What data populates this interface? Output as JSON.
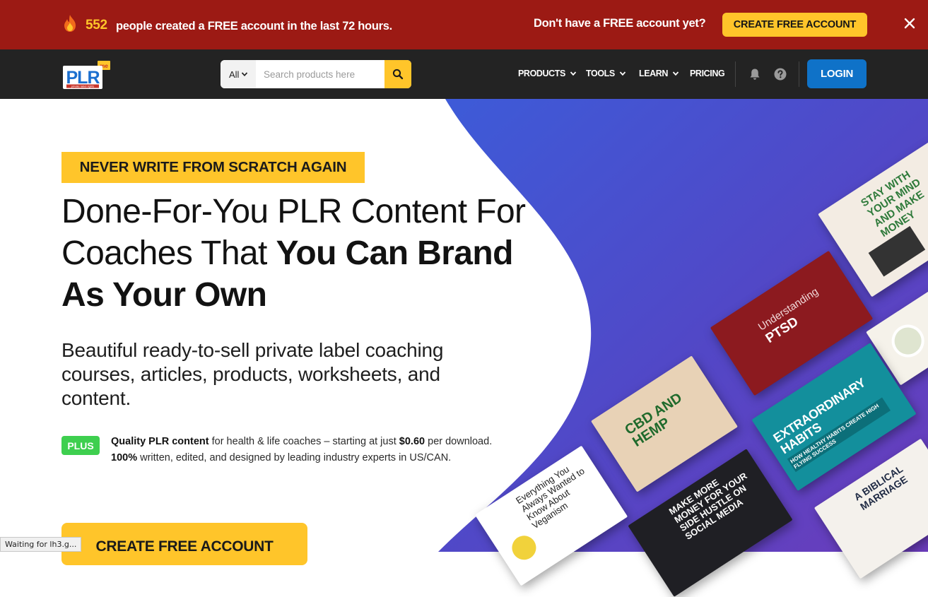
{
  "announcement": {
    "count": "552",
    "message": "people created a FREE account in the last 72 hours.",
    "question": "Don't have a FREE account yet?",
    "cta_label": "CREATE FREE ACCOUNT"
  },
  "nav": {
    "logo_text": "PLR",
    "logo_badge": "me",
    "logo_tagline": "private label rights",
    "search": {
      "category": "All",
      "placeholder": "Search products here"
    },
    "menu": [
      {
        "label": "PRODUCTS"
      },
      {
        "label": "TOOLS"
      },
      {
        "label": "LEARN"
      },
      {
        "label": "PRICING"
      }
    ],
    "login_label": "LOGIN"
  },
  "hero": {
    "tagline": "NEVER WRITE FROM SCRATCH AGAIN",
    "headline_regular": "Done-For-You PLR Content For Coaches That",
    "headline_bold": "You Can Brand As Your Own",
    "subheadline": "Beautiful ready-to-sell private label coaching courses, articles, products, worksheets, and content.",
    "plus_badge": "PLUS",
    "feature_bold_1": "Quality PLR content",
    "feature_text_1": "for health & life coaches – starting at just",
    "feature_price": "$0.60",
    "feature_text_2": "per download.",
    "feature_bold_2": "100%",
    "feature_text_3": "written, edited, and designed by leading industry experts in US/CAN.",
    "cta_label": "CREATE FREE ACCOUNT"
  },
  "covers": {
    "ptsd_title": "PTSD",
    "ptsd_pre": "Understanding",
    "cbd_title": "CBD AND HEMP",
    "habits_title": "EXTRAORDINARY HABITS",
    "habits_sub": "HOW HEALTHY HABITS CREATE HIGH FLYING SUCCESS",
    "vegan_title": "Everything You Always Wanted to Know About Veganism",
    "money_title": "MAKE MORE MONEY FOR YOUR SIDE HUSTLE ON SOCIAL MEDIA",
    "marriage_title": "A BIBLICAL MARRIAGE",
    "stay_title": "STAY WITH YOUR MIND AND MAKE MONEY"
  },
  "browser_status": "Waiting for lh3.g...",
  "colors": {
    "announcement_bg": "#9c1a14",
    "accent_yellow": "#ffc52a",
    "nav_bg": "#232323",
    "login_blue": "#0f72c8",
    "plus_green": "#3ecf4f",
    "hero_gradient_start": "#3a5bd6",
    "hero_gradient_end": "#6a3fbf"
  }
}
